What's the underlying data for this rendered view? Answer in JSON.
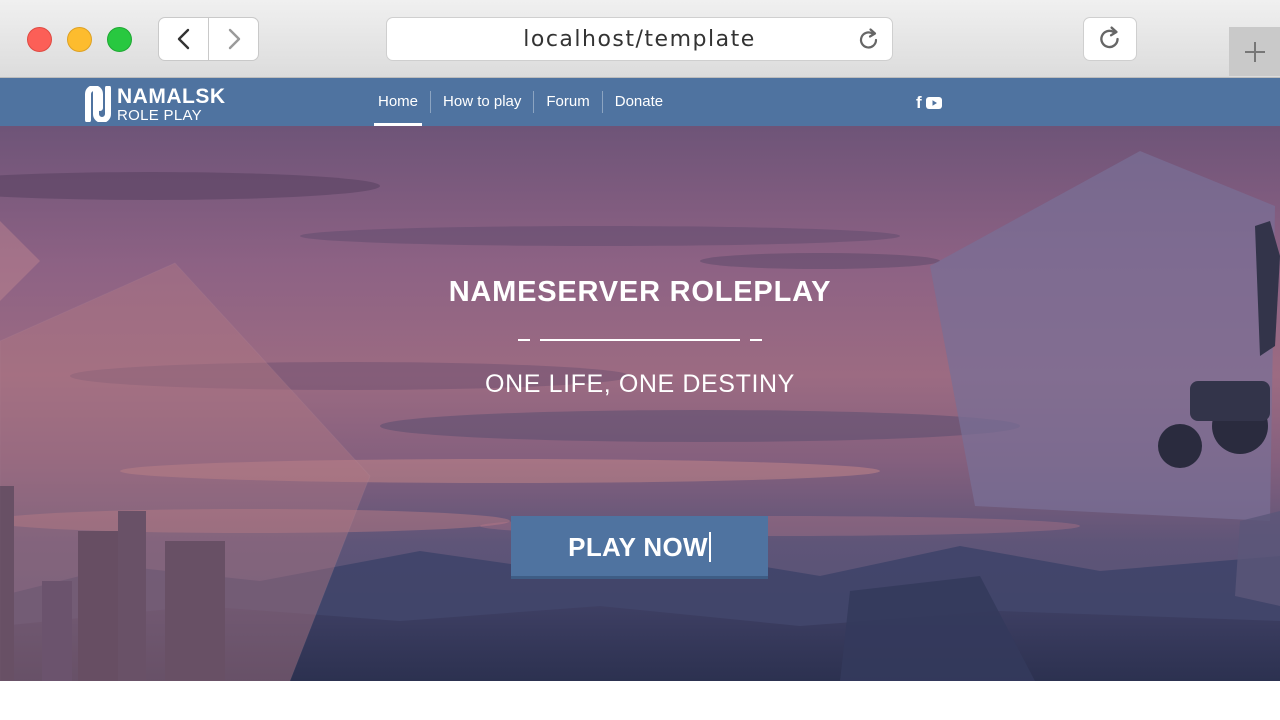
{
  "browser": {
    "url": "localhost/template"
  },
  "site": {
    "logo": {
      "line1": "NAMALSK",
      "line2": "ROLE PLAY"
    },
    "nav": [
      {
        "label": "Home",
        "active": true
      },
      {
        "label": "How to play",
        "active": false
      },
      {
        "label": "Forum",
        "active": false
      },
      {
        "label": "Donate",
        "active": false
      }
    ],
    "social": [
      "facebook-icon",
      "youtube-icon"
    ]
  },
  "hero": {
    "title": "NAMESERVER ROLEPLAY",
    "subtitle": "ONE LIFE, ONE DESTINY",
    "cta": "PLAY NOW"
  },
  "colors": {
    "brand": "#4f73a0",
    "text": "#ffffff"
  }
}
